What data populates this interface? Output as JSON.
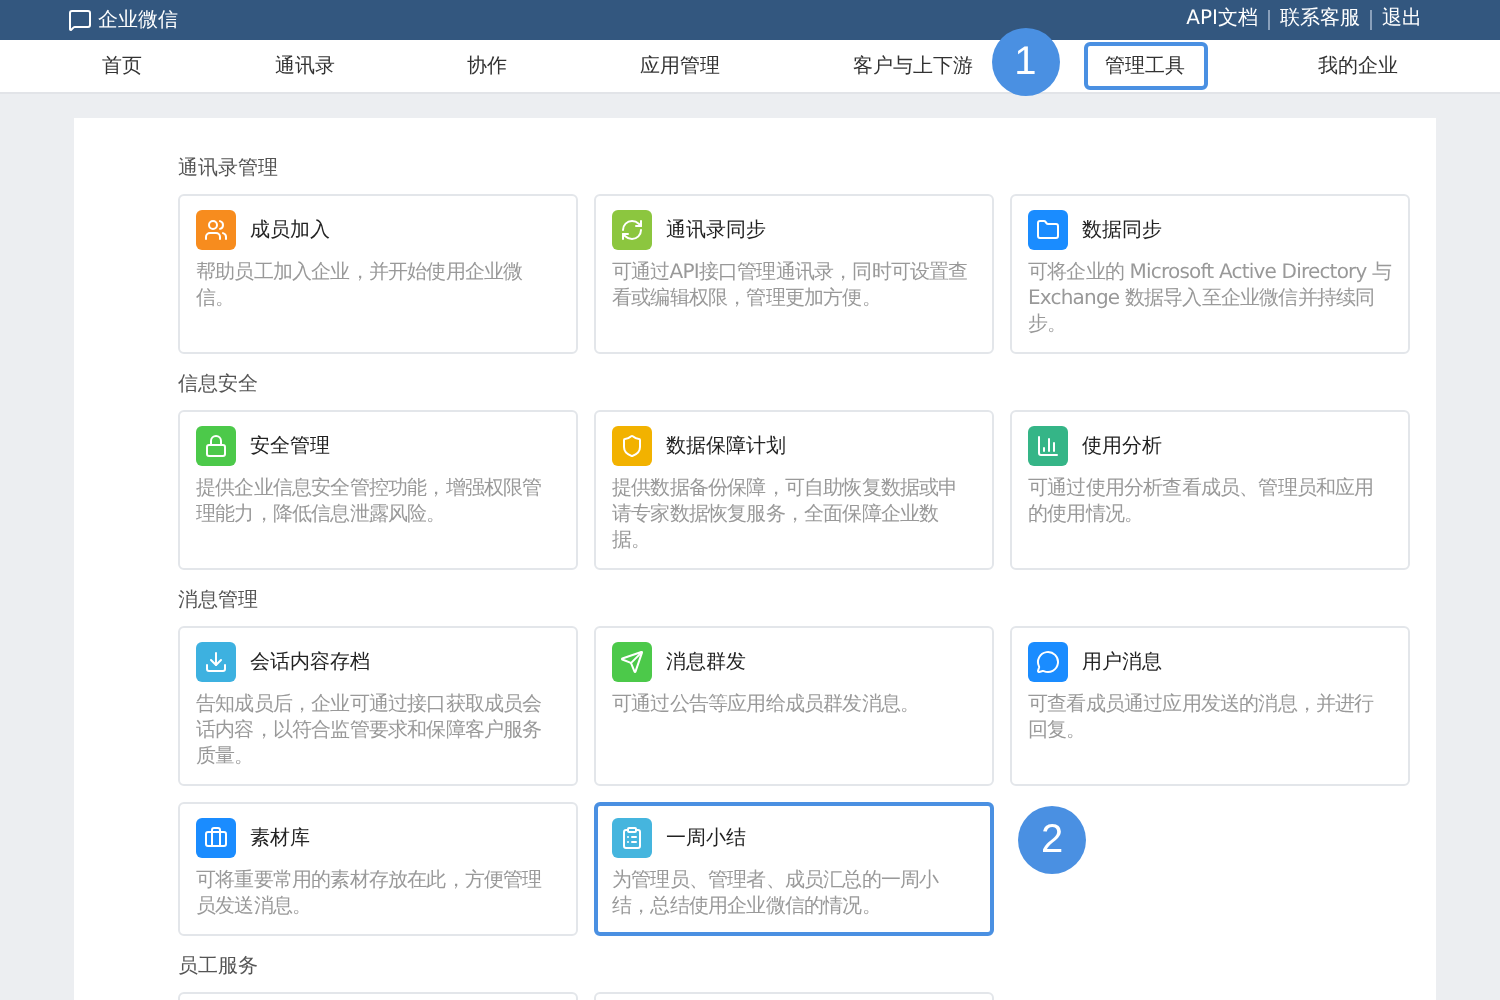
{
  "header": {
    "logo": "企业微信",
    "links": [
      "API文档",
      "联系客服",
      "退出"
    ]
  },
  "nav": [
    {
      "label": "首页",
      "highlighted": false
    },
    {
      "label": "通讯录",
      "highlighted": false
    },
    {
      "label": "协作",
      "highlighted": false
    },
    {
      "label": "应用管理",
      "highlighted": false
    },
    {
      "label": "客户与上下游",
      "highlighted": false
    },
    {
      "label": "管理工具",
      "highlighted": true,
      "callout": "1"
    },
    {
      "label": "我的企业",
      "highlighted": false
    }
  ],
  "sections": [
    {
      "title": "通讯录管理",
      "cards": [
        {
          "kind": "tool",
          "color": "#f78c1e",
          "title": "成员加入",
          "description": "帮助员工加入企业，并开始使用企业微信。",
          "highlighted": false
        },
        {
          "kind": "tool",
          "color": "#8cc63f",
          "title": "通讯录同步",
          "description": "可通过API接口管理通讯录，同时可设置查看或编辑权限，管理更加方便。",
          "highlighted": false
        },
        {
          "kind": "tool",
          "color": "#1a8cff",
          "title": "数据同步",
          "description": "可将企业的 Microsoft Active Directory 与 Exchange 数据导入至企业微信并持续同步。",
          "highlighted": false
        }
      ]
    },
    {
      "title": "信息安全",
      "cards": [
        {
          "kind": "tool",
          "color": "#4cc94a",
          "title": "安全管理",
          "description": "提供企业信息安全管控功能，增强权限管理能力，降低信息泄露风险。",
          "highlighted": false
        },
        {
          "kind": "tool",
          "color": "#f2b200",
          "title": "数据保障计划",
          "description": "提供数据备份保障，可自助恢复数据或申请专家数据恢复服务，全面保障企业数据。",
          "highlighted": false
        },
        {
          "kind": "tool",
          "color": "#35b587",
          "title": "使用分析",
          "description": "可通过使用分析查看成员、管理员和应用的使用情况。",
          "highlighted": false
        }
      ]
    },
    {
      "title": "消息管理",
      "cards": [
        {
          "kind": "tool",
          "color": "#3db1e0",
          "title": "会话内容存档",
          "description": "告知成员后，企业可通过接口获取成员会话内容，以符合监管要求和保障客户服务质量。",
          "highlighted": false
        },
        {
          "kind": "tool",
          "color": "#4cc94a",
          "title": "消息群发",
          "description": "可通过公告等应用给成员群发消息。",
          "highlighted": false
        },
        {
          "kind": "tool",
          "color": "#1a8cff",
          "title": "用户消息",
          "description": "可查看成员通过应用发送的消息，并进行回复。",
          "highlighted": false
        },
        {
          "kind": "tool",
          "color": "#1a8cff",
          "title": "素材库",
          "description": "可将重要常用的素材存放在此，方便管理员发送消息。",
          "highlighted": false
        },
        {
          "kind": "tool",
          "color": "#45b5de",
          "title": "一周小结",
          "description": "为管理员、管理者、成员汇总的一周小结，总结使用企业微信的情况。",
          "highlighted": true,
          "callout": "2"
        }
      ]
    },
    {
      "title": "员工服务",
      "cards": [
        {
          "kind": "cut"
        },
        {
          "kind": "cut"
        }
      ]
    }
  ]
}
